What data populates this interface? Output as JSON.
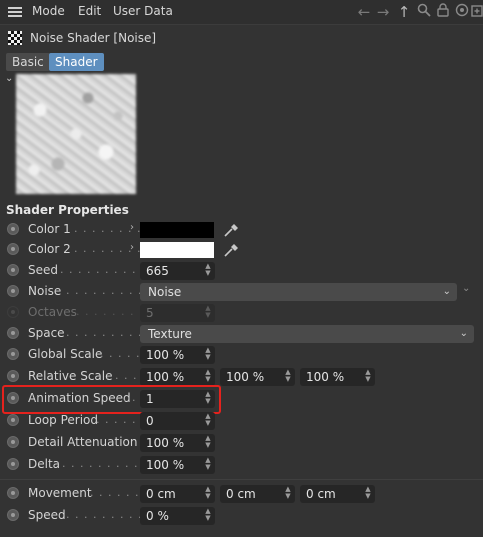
{
  "menu": {
    "items": [
      "Mode",
      "Edit",
      "User Data"
    ]
  },
  "title": "Noise Shader [Noise]",
  "tabs": [
    "Basic",
    "Shader"
  ],
  "section": "Shader Properties",
  "colors": {
    "color1": "#000000",
    "color2": "#ffffff",
    "highlight": "#e5221d",
    "active_tab": "#5e8fbf"
  },
  "props": {
    "color1": {
      "label": "Color 1"
    },
    "color2": {
      "label": "Color 2"
    },
    "seed": {
      "label": "Seed",
      "value": "665"
    },
    "noise": {
      "label": "Noise",
      "value": "Noise"
    },
    "octaves": {
      "label": "Octaves",
      "value": "5"
    },
    "space": {
      "label": "Space",
      "value": "Texture"
    },
    "global_scale": {
      "label": "Global Scale",
      "value": "100 %"
    },
    "relative_scale": {
      "label": "Relative Scale",
      "values": [
        "100 %",
        "100 %",
        "100 %"
      ]
    },
    "animation_speed": {
      "label": "Animation Speed",
      "value": "1"
    },
    "loop_period": {
      "label": "Loop Period",
      "value": "0"
    },
    "detail_attenuation": {
      "label": "Detail Attenuation",
      "value": "100 %"
    },
    "delta": {
      "label": "Delta",
      "value": "100 %"
    },
    "movement": {
      "label": "Movement",
      "values": [
        "0 cm",
        "0 cm",
        "0 cm"
      ]
    },
    "speed": {
      "label": "Speed",
      "value": "0 %"
    }
  }
}
